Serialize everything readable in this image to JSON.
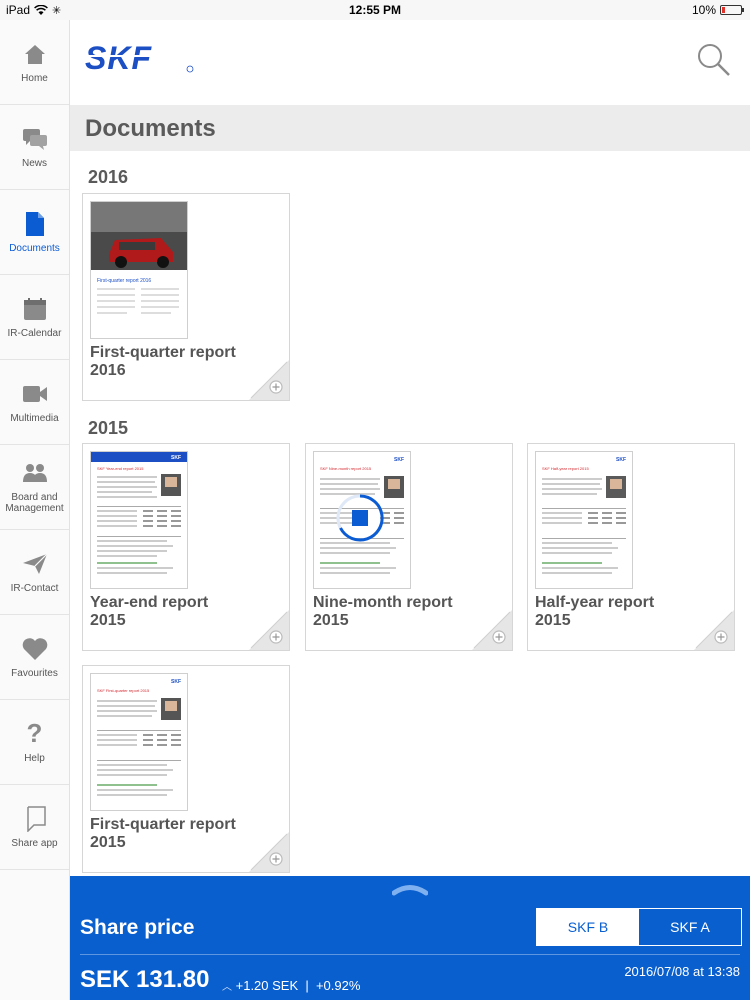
{
  "status_bar": {
    "device": "iPad",
    "time": "12:55 PM",
    "battery": "10%"
  },
  "sidebar": {
    "items": [
      {
        "label": "Home",
        "icon": "home-icon"
      },
      {
        "label": "News",
        "icon": "news-icon"
      },
      {
        "label": "Documents",
        "icon": "document-icon",
        "active": true
      },
      {
        "label": "IR-Calendar",
        "icon": "calendar-icon"
      },
      {
        "label": "Multimedia",
        "icon": "video-camera-icon"
      },
      {
        "label": "Board and Management",
        "icon": "people-icon"
      },
      {
        "label": "IR-Contact",
        "icon": "paper-plane-icon"
      },
      {
        "label": "Favourites",
        "icon": "heart-icon"
      },
      {
        "label": "Help",
        "icon": "question-mark-icon"
      },
      {
        "label": "Share app",
        "icon": "share-icon"
      }
    ]
  },
  "header": {
    "logo_text": "SKF",
    "page_title": "Documents"
  },
  "sections": [
    {
      "year": "2016",
      "documents": [
        {
          "title_line1": "First-quarter report",
          "title_line2": "2016",
          "thumb_heading": "First-quarter report 2016"
        }
      ]
    },
    {
      "year": "2015",
      "documents": [
        {
          "title_line1": "Year-end report",
          "title_line2": "2015",
          "thumb_heading": "SKF Year-end report 2015"
        },
        {
          "title_line1": "Nine-month report",
          "title_line2": "2015",
          "thumb_heading": "SKF Nine-month report 2015",
          "downloading": true
        },
        {
          "title_line1": "Half-year report",
          "title_line2": "2015",
          "thumb_heading": "SKF Half-year report 2015"
        },
        {
          "title_line1": "First-quarter report",
          "title_line2": "2015",
          "thumb_heading": "SKF First-quarter report 2015"
        }
      ]
    }
  ],
  "share_price": {
    "title": "Share price",
    "tabs": [
      "SKF B",
      "SKF A"
    ],
    "selected_tab": "SKF B",
    "price": "SEK 131.80",
    "change": "+1.20 SEK  |  +0.92%",
    "timestamp": "2016/07/08 at 13:38"
  },
  "colors": {
    "accent": "#0a5fcf",
    "brand": "#1c4fc4"
  }
}
